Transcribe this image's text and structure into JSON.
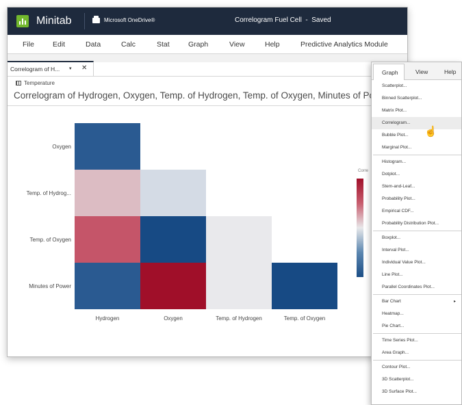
{
  "titlebar": {
    "app_name": "Minitab",
    "drive_label": "Microsoft OneDrive®",
    "document_title": "Correlogram Fuel Cell  -  Saved"
  },
  "menubar": {
    "items": [
      "File",
      "Edit",
      "Data",
      "Calc",
      "Stat",
      "Graph",
      "View",
      "Help",
      "Predictive Analytics Module"
    ]
  },
  "tab": {
    "label": "Correlogram of H...",
    "dropdown": "▾",
    "close": "✕"
  },
  "worksheet": {
    "label": "Temperature"
  },
  "graph": {
    "title": "Correlogram of Hydrogen, Oxygen, Temp. of Hydrogen, Temp. of Oxygen, Minutes of Power",
    "row_labels": [
      "Oxygen",
      "Temp. of Hydrog...",
      "Temp. of Oxygen",
      "Minutes of Power"
    ],
    "column_labels": [
      "Hydrogen",
      "Oxygen",
      "Temp. of Hydrogen",
      "Temp. of Oxygen"
    ],
    "legend_title": "Corre",
    "colors": {
      "strong_positive": "#a00f29",
      "positive": "#c55569",
      "weak_positive": "#dcbcc3",
      "neutral": "#e9e9ec",
      "weak_negative": "#d4dbe5",
      "negative": "#2a5a91",
      "strong_negative": "#174a84"
    }
  },
  "chart_data": {
    "type": "heatmap",
    "rows": [
      "Oxygen",
      "Temp. of Hydrog...",
      "Temp. of Oxygen",
      "Minutes of Power"
    ],
    "columns": [
      "Hydrogen",
      "Oxygen",
      "Temp. of Hydrogen",
      "Temp. of Oxygen"
    ],
    "values": [
      [
        -0.7,
        null,
        null,
        null
      ],
      [
        0.3,
        -0.2,
        null,
        null
      ],
      [
        0.6,
        -0.8,
        0.0,
        null
      ],
      [
        -0.7,
        0.9,
        0.0,
        -0.8
      ]
    ],
    "colorbar_range": [
      -1,
      1
    ]
  },
  "graph_menu": {
    "tabs": [
      "Graph",
      "View",
      "Help"
    ],
    "groups": [
      [
        "Scatterplot...",
        "Binned Scatterplot...",
        "Matrix Plot...",
        "Correlogram...",
        "Bubble Plot...",
        "Marginal Plot..."
      ],
      [
        "Histogram...",
        "Dotplot...",
        "Stem-and-Leaf...",
        "Probability Plot...",
        "Empirical CDF...",
        "Probability Distribution Plot..."
      ],
      [
        "Boxplot...",
        "Interval Plot...",
        "Individual Value Plot...",
        "Line Plot...",
        "Parallel Coordinates Plot..."
      ],
      [
        "Bar Chart",
        "Heatmap...",
        "Pie Chart..."
      ],
      [
        "Time Series Plot...",
        "Area Graph..."
      ],
      [
        "Contour Plot...",
        "3D Scatterplot...",
        "3D Surface Plot..."
      ]
    ],
    "hovered_item": "Correlogram...",
    "submenu_item": "Bar Chart"
  }
}
